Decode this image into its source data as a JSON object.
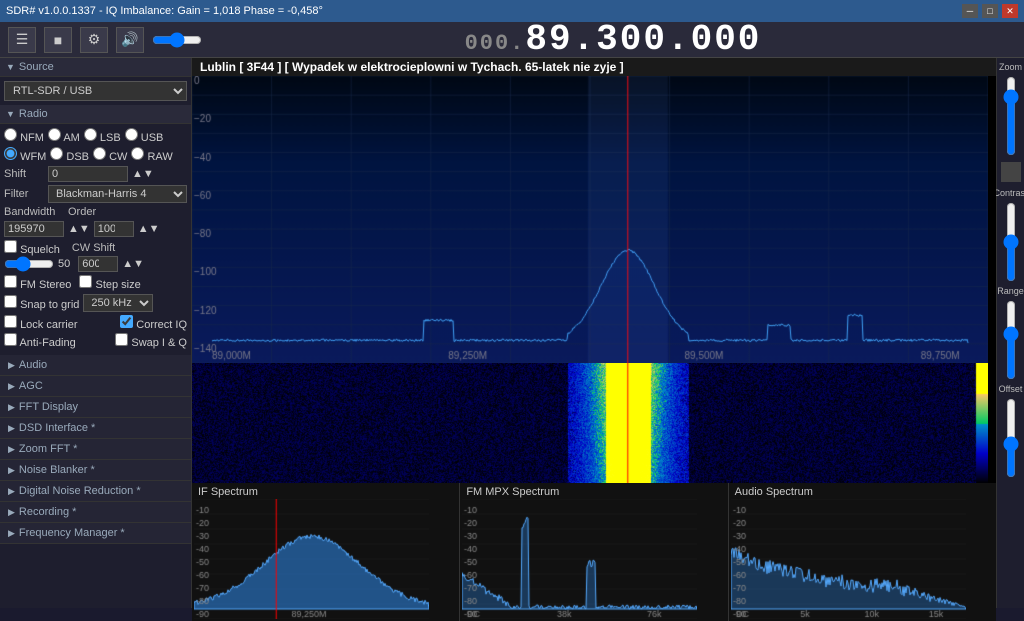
{
  "titlebar": {
    "title": "SDR# v1.0.0.1337 - IQ Imbalance: Gain = 1,018 Phase = -0,458°",
    "min_label": "─",
    "max_label": "□",
    "close_label": "✕"
  },
  "toolbar": {
    "hamburger": "☰",
    "stop": "■",
    "gear": "⚙",
    "volume": "🔊"
  },
  "frequency": {
    "prefix": "000.",
    "main": "89.300.000"
  },
  "source": {
    "label": "Source",
    "device": "RTL-SDR / USB"
  },
  "radio": {
    "label": "Radio",
    "modes": [
      "NFM",
      "AM",
      "LSB",
      "USB",
      "WFM",
      "DSB",
      "CW",
      "RAW"
    ],
    "selected_mode": "WFM",
    "shift_label": "Shift",
    "shift_value": "0",
    "filter_label": "Filter",
    "filter_value": "Blackman-Harris 4",
    "bandwidth_label": "Bandwidth",
    "bandwidth_value": "195970",
    "order_label": "Order",
    "order_value": "100",
    "squelch_label": "Squelch",
    "squelch_value": "50",
    "cw_shift_label": "CW Shift",
    "cw_shift_value": "600",
    "fm_stereo_label": "FM Stereo",
    "step_size_label": "Step size",
    "snap_to_grid_label": "Snap to grid",
    "snap_value": "250 kHz",
    "lock_carrier_label": "Lock carrier",
    "correct_iq_label": "Correct IQ",
    "anti_fading_label": "Anti-Fading",
    "swap_iq_label": "Swap I & Q"
  },
  "sidebar_sections": [
    {
      "label": "Audio",
      "asterisk": ""
    },
    {
      "label": "AGC",
      "asterisk": ""
    },
    {
      "label": "FFT Display",
      "asterisk": ""
    },
    {
      "label": "DSD Interface",
      "asterisk": "*"
    },
    {
      "label": "Zoom FFT",
      "asterisk": "*"
    },
    {
      "label": "Noise Blanker",
      "asterisk": "*"
    },
    {
      "label": "Digital Noise Reduction",
      "asterisk": "*"
    },
    {
      "label": "Recording",
      "asterisk": "*"
    },
    {
      "label": "Frequency Manager",
      "asterisk": "*"
    }
  ],
  "info_bar": {
    "text": "Lublin  [ 3F44 ]  [ Wypadek w elektrocieplowni w Tychach. 65-latek nie zyje ]"
  },
  "spectrum": {
    "freq_labels": [
      "89,000M",
      "89,250M",
      "89,500M",
      "89,750M"
    ],
    "db_labels": [
      "-20",
      "-40",
      "-60",
      "-80",
      "-100",
      "-120",
      "-140"
    ],
    "db_min": "-150",
    "db_max": "0"
  },
  "panels": [
    {
      "title": "IF Spectrum",
      "x_label": "89,250M"
    },
    {
      "title": "FM MPX Spectrum",
      "x_labels": [
        "DC",
        "38k",
        "76k"
      ]
    },
    {
      "title": "Audio Spectrum",
      "x_labels": [
        "DC",
        "5k",
        "10k",
        "15k"
      ]
    }
  ],
  "right_sidebar": {
    "zoom_label": "Zoom",
    "contrast_label": "Contrast",
    "range_label": "Range",
    "offset_label": "Offset"
  }
}
